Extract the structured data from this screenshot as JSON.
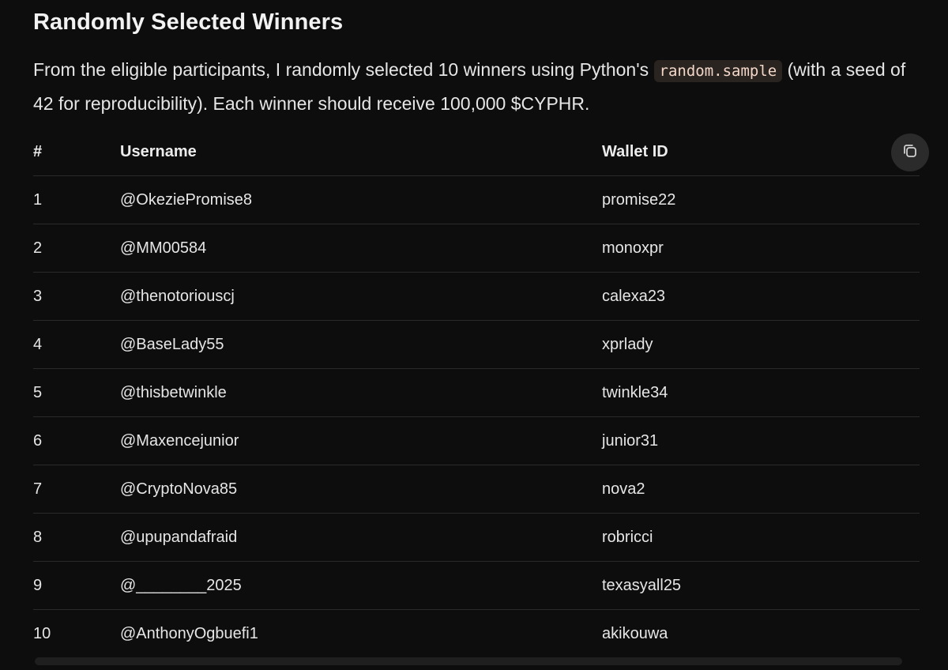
{
  "section": {
    "heading": "Randomly Selected Winners",
    "intro_before_code": "From the eligible participants, I randomly selected 10 winners using Python's ",
    "intro_code": "random.sample",
    "intro_after_code": " (with a seed of 42 for reproducibility). Each winner should receive 100,000 $CYPHR."
  },
  "table": {
    "headers": {
      "num": "#",
      "username": "Username",
      "wallet": "Wallet ID"
    },
    "rows": [
      {
        "num": "1",
        "username": "@OkeziePromise8",
        "wallet": "promise22"
      },
      {
        "num": "2",
        "username": "@MM00584",
        "wallet": "monoxpr"
      },
      {
        "num": "3",
        "username": "@thenotoriouscj",
        "wallet": "calexa23"
      },
      {
        "num": "4",
        "username": "@BaseLady55",
        "wallet": "xprlady"
      },
      {
        "num": "5",
        "username": "@thisbetwinkle",
        "wallet": "twinkle34"
      },
      {
        "num": "6",
        "username": "@Maxencejunior",
        "wallet": "junior31"
      },
      {
        "num": "7",
        "username": "@CryptoNova85",
        "wallet": "nova2"
      },
      {
        "num": "8",
        "username": "@upupandafraid",
        "wallet": "robricci"
      },
      {
        "num": "9",
        "username": "@________2025",
        "wallet": "texasyall25"
      },
      {
        "num": "10",
        "username": "@AnthonyOgbuefi1",
        "wallet": "akikouwa"
      }
    ]
  },
  "icons": {
    "copy": "copy-icon"
  },
  "colors": {
    "background": "#0d0d0d",
    "code_background": "#2a2421",
    "divider": "#2a2a2a"
  }
}
